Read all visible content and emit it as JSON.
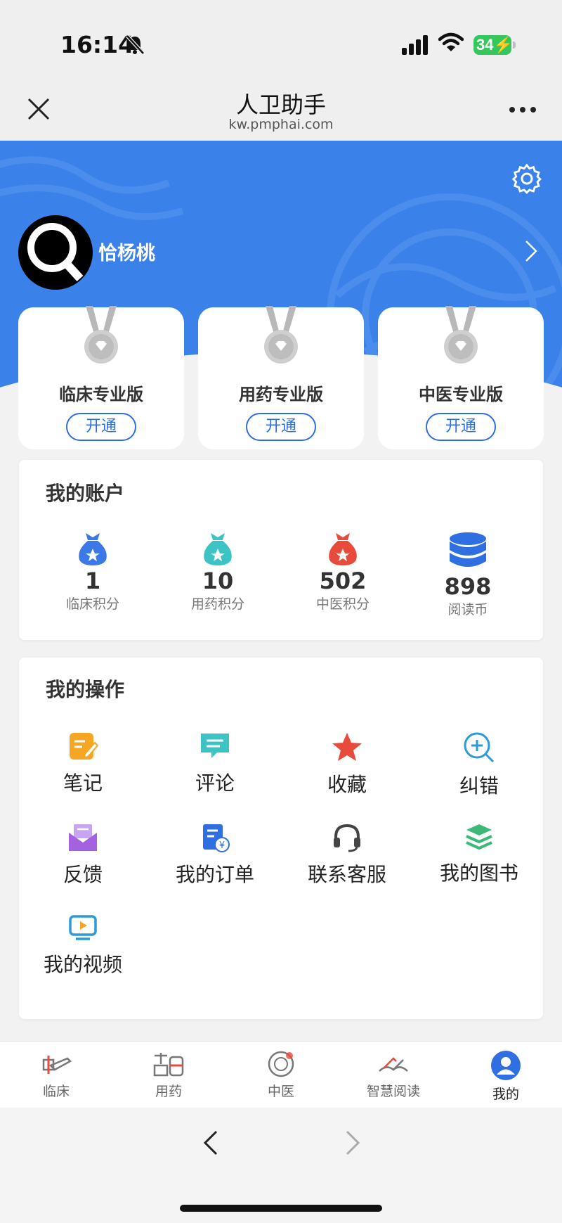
{
  "status": {
    "time": "16:14",
    "battery": "34"
  },
  "nav": {
    "title": "人卫助手",
    "url": "kw.pmphai.com"
  },
  "profile": {
    "username": "恰杨桃"
  },
  "memberships": [
    {
      "title": "临床专业版",
      "button": "开通"
    },
    {
      "title": "用药专业版",
      "button": "开通"
    },
    {
      "title": "中医专业版",
      "button": "开通"
    }
  ],
  "account": {
    "title": "我的账户",
    "items": [
      {
        "value": "1",
        "label": "临床积分",
        "icon": "money-bag-blue-icon",
        "color": "#3b7ae6"
      },
      {
        "value": "10",
        "label": "用药积分",
        "icon": "money-bag-teal-icon",
        "color": "#3cc4c4"
      },
      {
        "value": "502",
        "label": "中医积分",
        "icon": "money-bag-red-icon",
        "color": "#e84a3c"
      },
      {
        "value": "898",
        "label": "阅读币",
        "icon": "coin-stack-icon",
        "color": "#2f6fe2"
      }
    ]
  },
  "operations": {
    "title": "我的操作",
    "items": [
      {
        "label": "笔记",
        "icon": "note-icon"
      },
      {
        "label": "评论",
        "icon": "comment-icon"
      },
      {
        "label": "收藏",
        "icon": "star-icon"
      },
      {
        "label": "纠错",
        "icon": "correction-icon"
      },
      {
        "label": "反馈",
        "icon": "feedback-icon"
      },
      {
        "label": "我的订单",
        "icon": "order-icon"
      },
      {
        "label": "联系客服",
        "icon": "headset-icon"
      },
      {
        "label": "我的图书",
        "icon": "books-icon"
      },
      {
        "label": "我的视频",
        "icon": "video-icon"
      }
    ]
  },
  "tabs": [
    {
      "label": "临床",
      "icon": "clinical-icon"
    },
    {
      "label": "用药",
      "icon": "medicine-icon"
    },
    {
      "label": "中医",
      "icon": "tcm-icon"
    },
    {
      "label": "智慧阅读",
      "icon": "reading-icon"
    },
    {
      "label": "我的",
      "icon": "user-icon",
      "active": true
    }
  ],
  "colors": {
    "brand_blue": "#3a82ea",
    "button_blue": "#2e6fe0"
  }
}
